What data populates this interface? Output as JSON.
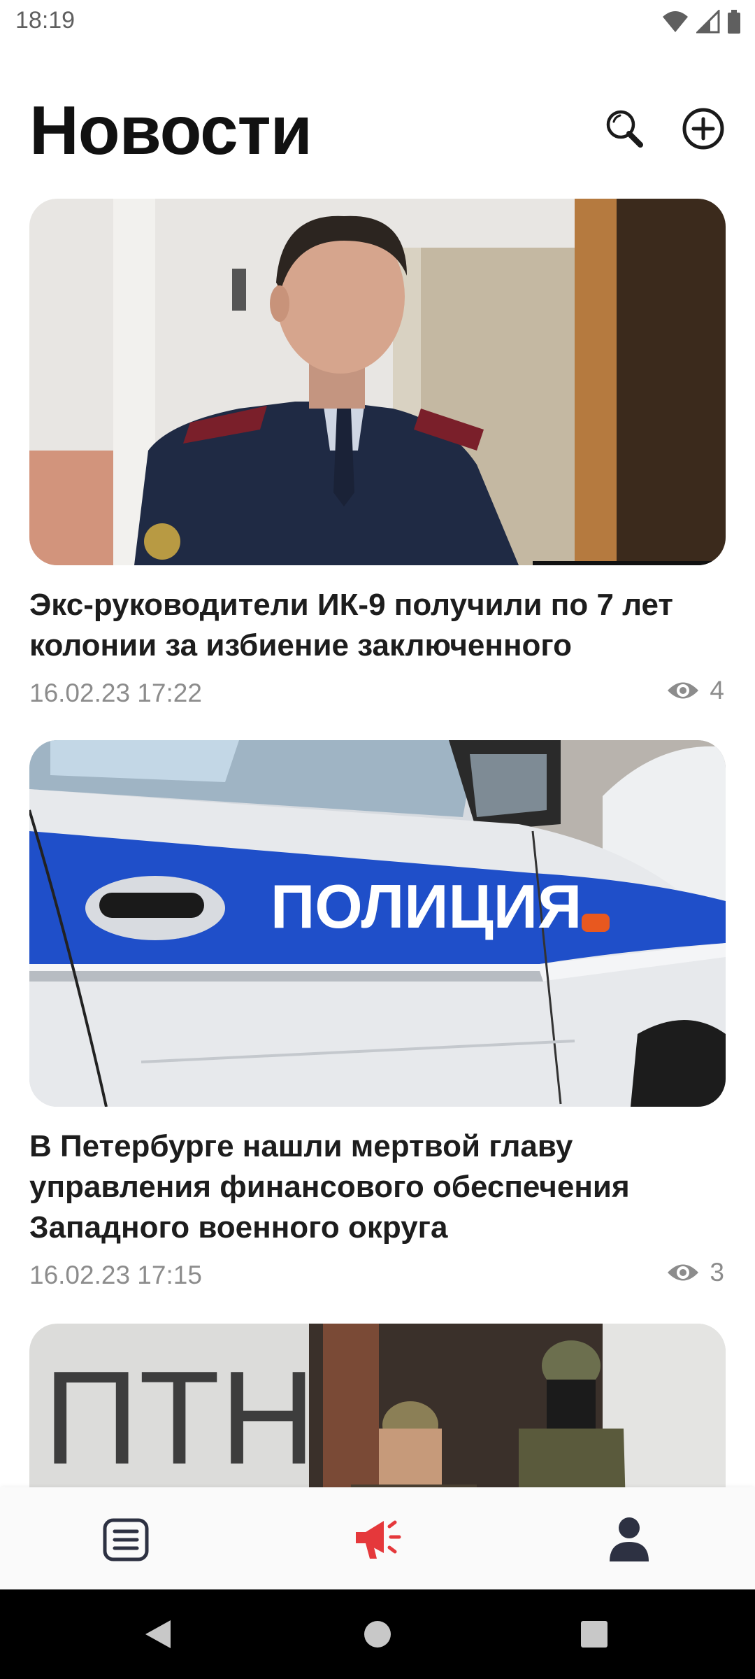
{
  "status_bar": {
    "time": "18:19"
  },
  "header": {
    "title": "Новости"
  },
  "articles": [
    {
      "title": "Экс-руководители ИК-9 получили по 7 лет колонии за избиение заключенного",
      "date": "16.02.23 17:22",
      "views": "4",
      "image_icon": "officer-photo"
    },
    {
      "title": "В Петербурге нашли мертвой главу управления финансового обеспечения Западного военного округа",
      "date": "16.02.23 17:15",
      "views": "3",
      "image_icon": "police-car-photo",
      "image_text": "ПОЛИЦИЯ"
    },
    {
      "image_icon": "soldiers-photo",
      "image_text": "ПТН"
    }
  ],
  "bottom_nav": {
    "items": [
      {
        "icon": "list-icon",
        "active": false
      },
      {
        "icon": "megaphone-icon",
        "active": true
      },
      {
        "icon": "person-icon",
        "active": false
      }
    ],
    "active_color": "#e5383b",
    "inactive_color": "#2d3142"
  }
}
